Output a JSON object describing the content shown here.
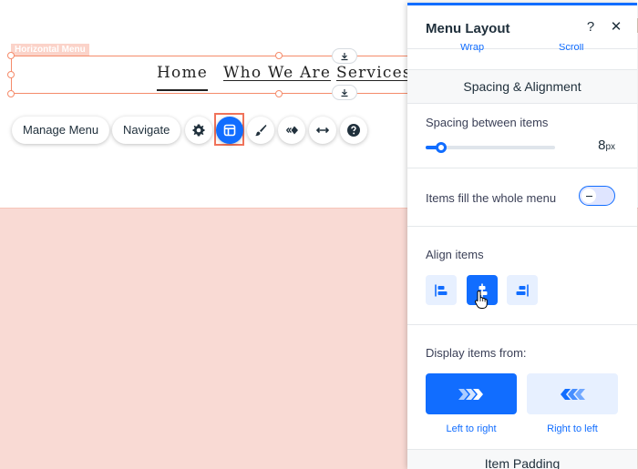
{
  "canvas": {
    "component_tag": "Horizontal Menu",
    "menu_items": [
      "Home",
      "Who We Are",
      "Services"
    ],
    "toolbar": {
      "manage_menu": "Manage Menu",
      "navigate": "Navigate"
    },
    "icons": [
      "gear-icon",
      "layout-icon",
      "brush-icon",
      "animation-icon",
      "stretch-icon",
      "help-icon",
      "download-icon"
    ]
  },
  "panel": {
    "title": "Menu Layout",
    "help": "?",
    "close": "✕",
    "cut_left": "Wrap",
    "cut_right": "Scroll",
    "section_spacing": "Spacing & Alignment",
    "spacing_label": "Spacing between items",
    "spacing_value": "8",
    "spacing_unit": "px",
    "spacing_fraction": 0.12,
    "fill_label": "Items fill the whole menu",
    "fill_enabled": false,
    "align_label": "Align items",
    "align_selected": "center",
    "display_label": "Display items from:",
    "ltr_label": "Left to right",
    "rtl_label": "Right to left",
    "direction_selected": "ltr",
    "next_section": "Item Padding"
  },
  "colors": {
    "accent": "#116dff",
    "accent_light": "#e7f0ff",
    "selection": "#f58b6a",
    "canvas_section": "#f9dad4"
  }
}
